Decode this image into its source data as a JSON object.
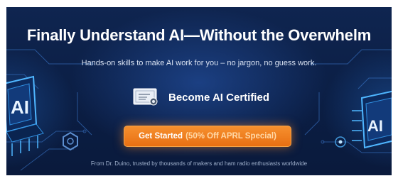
{
  "banner": {
    "headline": "Finally Understand AI—Without the Overwhelm",
    "subhead": "Hands-on skills to make AI work for you – no jargon, no guess work.",
    "certification": "Become AI Certified",
    "cta": {
      "label": "Get Started",
      "offer": "(50% Off APRL Special)"
    },
    "footer": "From Dr. Duino, trusted by thousands of makers and ham radio enthusiasts worldwide",
    "left_chip_label": "AI",
    "right_chip_label": "AI"
  },
  "colors": {
    "background": "#0b1e44",
    "cta": "#f6902f",
    "headline": "#ffffff",
    "glow": "#4fb6ff"
  }
}
